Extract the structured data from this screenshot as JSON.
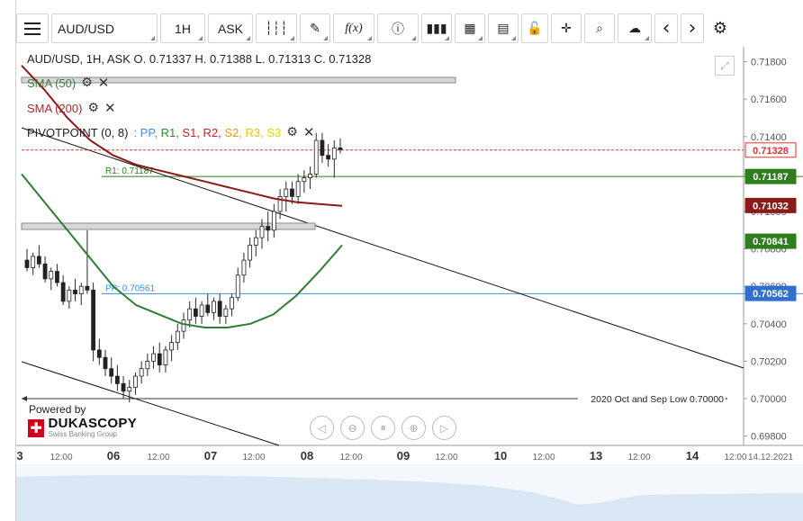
{
  "toolbar": {
    "menu_icon": "hamburger-menu-icon",
    "symbol": "AUD/USD",
    "timeframe": "1H",
    "price_side": "ASK",
    "buttons": [
      {
        "name": "candle-type-icon",
        "glyph": "┆┆┆"
      },
      {
        "name": "draw-pencil-icon",
        "glyph": "✎"
      },
      {
        "name": "function-icon",
        "glyph": "f(x)"
      },
      {
        "name": "info-icon",
        "glyph": "ⓘ"
      },
      {
        "name": "bar-chart-icon",
        "glyph": "▮▮▮"
      },
      {
        "name": "calendar-icon",
        "glyph": "▦"
      },
      {
        "name": "calculator-icon",
        "glyph": "▤"
      },
      {
        "name": "lock-icon",
        "glyph": "🔓"
      },
      {
        "name": "crosshair-icon",
        "glyph": "✛"
      },
      {
        "name": "zoom-icon",
        "glyph": "⌕"
      },
      {
        "name": "upload-icon",
        "glyph": "☁"
      },
      {
        "name": "prev-icon",
        "glyph": "‹"
      },
      {
        "name": "next-icon",
        "glyph": "›"
      }
    ],
    "settings_icon": "gear-icon"
  },
  "chart": {
    "info_line": "AUD/USD, 1H, ASK   O. 0.71337 H. 0.71388 L. 0.71313 C. 0.71328",
    "indicators": [
      {
        "label": "SMA (50)",
        "color": "#3b7d3b"
      },
      {
        "label": "SMA (200)",
        "color": "#a52a2a"
      }
    ],
    "pivot": {
      "label": "PIVOTPOINT (0, 8)",
      "parts": [
        {
          "text": ": PP,",
          "color": "#3d8fe0"
        },
        {
          "text": " R1,",
          "color": "#2e8b2e"
        },
        {
          "text": " S1,",
          "color": "#cc2222"
        },
        {
          "text": " R2,",
          "color": "#cc2222"
        },
        {
          "text": " S2,",
          "color": "#e8a000"
        },
        {
          "text": " R3,",
          "color": "#e8c800"
        },
        {
          "text": " S3",
          "color": "#e8d800"
        }
      ]
    },
    "level_labels": {
      "r1": "R1: 0.71187",
      "pp": "PP: 0.70561"
    },
    "annotation": "2020 Oct and Sep Low  0.70000",
    "y_ticks": [
      "0.71800",
      "0.71600",
      "0.71400",
      "0.71200",
      "0.71000",
      "0.70800",
      "0.70600",
      "0.70400",
      "0.70200",
      "0.70000",
      "0.69800"
    ],
    "price_tags": [
      {
        "value": "0.71328",
        "bg": "#ffffff",
        "fg": "#e03030",
        "border": "#e03030"
      },
      {
        "value": "0.71187",
        "bg": "#2e7d1e",
        "fg": "#ffffff"
      },
      {
        "value": "0.71032",
        "bg": "#8b1a1a",
        "fg": "#ffffff"
      },
      {
        "value": "0.70841",
        "bg": "#2e7d1e",
        "fg": "#ffffff"
      },
      {
        "value": "0.70562",
        "bg": "#2f6fd0",
        "fg": "#ffffff"
      }
    ],
    "x_ticks": [
      "3",
      "12:00",
      "06",
      "12:00",
      "07",
      "12:00",
      "08",
      "12:00",
      "09",
      "12:00",
      "10",
      "12:00",
      "13",
      "12:00",
      "14",
      "12:00",
      "14.12.2021"
    ],
    "powered_by": "Powered by",
    "brand": "DUKASCOPY",
    "brand_tag": "Swiss Banking Group",
    "nav_controls": [
      "◁",
      "⊖",
      "⏸",
      "⊕",
      "▷"
    ]
  },
  "chart_data": {
    "type": "candlestick",
    "symbol": "AUD/USD",
    "timeframe": "1H",
    "ylim": [
      0.6975,
      0.7188
    ],
    "candles": [
      [
        0.7074,
        0.708,
        0.7068,
        0.707
      ],
      [
        0.707,
        0.7078,
        0.7066,
        0.7076
      ],
      [
        0.7076,
        0.7082,
        0.707,
        0.7072
      ],
      [
        0.7072,
        0.7076,
        0.7062,
        0.7064
      ],
      [
        0.7064,
        0.707,
        0.7058,
        0.7068
      ],
      [
        0.7068,
        0.7072,
        0.706,
        0.7062
      ],
      [
        0.7062,
        0.7066,
        0.705,
        0.7052
      ],
      [
        0.7052,
        0.706,
        0.7048,
        0.7058
      ],
      [
        0.7058,
        0.7064,
        0.7052,
        0.7056
      ],
      [
        0.7056,
        0.7062,
        0.705,
        0.706
      ],
      [
        0.706,
        0.709,
        0.7056,
        0.7058
      ],
      [
        0.7058,
        0.7062,
        0.702,
        0.7026
      ],
      [
        0.7026,
        0.7032,
        0.7018,
        0.7022
      ],
      [
        0.7022,
        0.7026,
        0.7012,
        0.7016
      ],
      [
        0.7016,
        0.7022,
        0.7008,
        0.7012
      ],
      [
        0.7012,
        0.7018,
        0.7004,
        0.7008
      ],
      [
        0.7008,
        0.7012,
        0.7,
        0.7004
      ],
      [
        0.7004,
        0.701,
        0.6998,
        0.7006
      ],
      [
        0.7006,
        0.7014,
        0.7002,
        0.7012
      ],
      [
        0.7012,
        0.702,
        0.7008,
        0.7016
      ],
      [
        0.7016,
        0.7024,
        0.7012,
        0.702
      ],
      [
        0.702,
        0.7028,
        0.7016,
        0.7024
      ],
      [
        0.7024,
        0.703,
        0.7014,
        0.7018
      ],
      [
        0.7018,
        0.7028,
        0.7014,
        0.7026
      ],
      [
        0.7026,
        0.7034,
        0.702,
        0.703
      ],
      [
        0.703,
        0.704,
        0.7026,
        0.7036
      ],
      [
        0.7036,
        0.7046,
        0.7032,
        0.7042
      ],
      [
        0.7042,
        0.7052,
        0.7038,
        0.7048
      ],
      [
        0.7048,
        0.7054,
        0.704,
        0.7044
      ],
      [
        0.7044,
        0.7052,
        0.704,
        0.705
      ],
      [
        0.705,
        0.7056,
        0.7044,
        0.7046
      ],
      [
        0.7046,
        0.7054,
        0.7042,
        0.7052
      ],
      [
        0.7052,
        0.7056,
        0.704,
        0.7044
      ],
      [
        0.7044,
        0.705,
        0.704,
        0.7048
      ],
      [
        0.7048,
        0.7056,
        0.7044,
        0.7054
      ],
      [
        0.7054,
        0.707,
        0.7052,
        0.7066
      ],
      [
        0.7066,
        0.7078,
        0.7062,
        0.7074
      ],
      [
        0.7074,
        0.7086,
        0.707,
        0.7082
      ],
      [
        0.7082,
        0.709,
        0.7076,
        0.7086
      ],
      [
        0.7086,
        0.7096,
        0.708,
        0.7092
      ],
      [
        0.7092,
        0.71,
        0.7084,
        0.709
      ],
      [
        0.709,
        0.7104,
        0.7086,
        0.71
      ],
      [
        0.71,
        0.7112,
        0.7096,
        0.7108
      ],
      [
        0.7108,
        0.7116,
        0.71,
        0.7112
      ],
      [
        0.7112,
        0.7116,
        0.7104,
        0.7108
      ],
      [
        0.7108,
        0.712,
        0.7104,
        0.7116
      ],
      [
        0.7116,
        0.7122,
        0.711,
        0.7118
      ],
      [
        0.7118,
        0.7124,
        0.7112,
        0.712
      ],
      [
        0.712,
        0.7142,
        0.7118,
        0.7138
      ],
      [
        0.7138,
        0.7142,
        0.7126,
        0.713
      ],
      [
        0.713,
        0.7136,
        0.7124,
        0.7128
      ],
      [
        0.7128,
        0.7138,
        0.7118,
        0.7134
      ],
      [
        0.7134,
        0.7139,
        0.7131,
        0.7133
      ]
    ],
    "series": [
      {
        "name": "SMA (50)",
        "values": [
          0.712,
          0.7105,
          0.709,
          0.7075,
          0.706,
          0.705,
          0.7045,
          0.704,
          0.7038,
          0.7038,
          0.704,
          0.7045,
          0.7055,
          0.7068,
          0.7082
        ]
      },
      {
        "name": "SMA (200)",
        "values": [
          0.7178,
          0.7165,
          0.715,
          0.7138,
          0.713,
          0.7125,
          0.7122,
          0.7119,
          0.7116,
          0.7113,
          0.711,
          0.7107,
          0.7105,
          0.7104,
          0.7103
        ]
      }
    ],
    "levels": [
      {
        "name": "R1",
        "value": 0.71187
      },
      {
        "name": "PP",
        "value": 0.70561
      },
      {
        "name": "2020 Oct and Sep Low",
        "value": 0.7
      }
    ],
    "ylabel": ""
  }
}
